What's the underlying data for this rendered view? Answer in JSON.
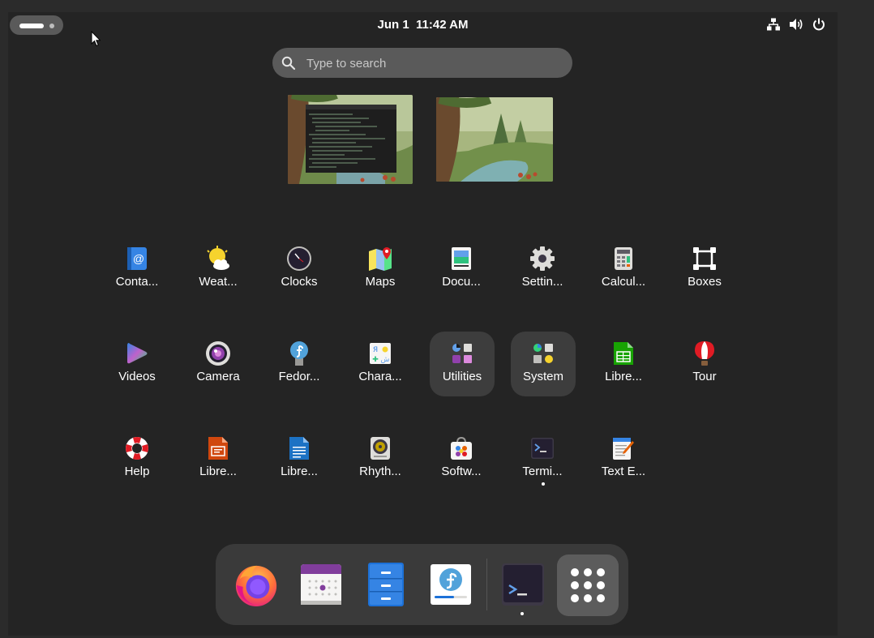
{
  "topbar": {
    "clock_date": "Jun 1",
    "clock_time": "11:42 AM",
    "tray_icons": [
      "network-icon",
      "volume-icon",
      "power-icon"
    ]
  },
  "search": {
    "placeholder": "Type to search",
    "value": ""
  },
  "workspaces": [
    "workspace-1-thumbnail",
    "workspace-2-thumbnail"
  ],
  "app_grid": {
    "rows": [
      [
        {
          "label": "Conta...",
          "icon": "contacts-icon"
        },
        {
          "label": "Weat...",
          "icon": "weather-icon"
        },
        {
          "label": "Clocks",
          "icon": "clocks-icon"
        },
        {
          "label": "Maps",
          "icon": "maps-icon"
        },
        {
          "label": "Docu...",
          "icon": "document-viewer-icon"
        },
        {
          "label": "Settin...",
          "icon": "settings-icon"
        },
        {
          "label": "Calcul...",
          "icon": "calculator-icon"
        },
        {
          "label": "Boxes",
          "icon": "boxes-icon"
        }
      ],
      [
        {
          "label": "Videos",
          "icon": "videos-icon"
        },
        {
          "label": "Camera",
          "icon": "camera-icon"
        },
        {
          "label": "Fedor...",
          "icon": "fedora-media-writer-icon"
        },
        {
          "label": "Chara...",
          "icon": "characters-icon"
        },
        {
          "label": "Utilities",
          "icon": "utilities-folder-icon"
        },
        {
          "label": "System",
          "icon": "system-folder-icon"
        },
        {
          "label": "Libre...",
          "icon": "libreoffice-calc-icon"
        },
        {
          "label": "Tour",
          "icon": "tour-icon"
        }
      ],
      [
        {
          "label": "Help",
          "icon": "help-icon"
        },
        {
          "label": "Libre...",
          "icon": "libreoffice-impress-icon"
        },
        {
          "label": "Libre...",
          "icon": "libreoffice-writer-icon"
        },
        {
          "label": "Rhyth...",
          "icon": "rhythmbox-icon"
        },
        {
          "label": "Softw...",
          "icon": "software-icon"
        },
        {
          "label": "Termi...",
          "icon": "terminal-icon"
        },
        {
          "label": "Text E...",
          "icon": "text-editor-icon"
        }
      ]
    ]
  },
  "dash": {
    "items": [
      "firefox-icon",
      "calendar-icon",
      "files-icon",
      "fedora-installer-icon",
      "terminal-icon"
    ],
    "show_apps": "show-apps-icon"
  }
}
